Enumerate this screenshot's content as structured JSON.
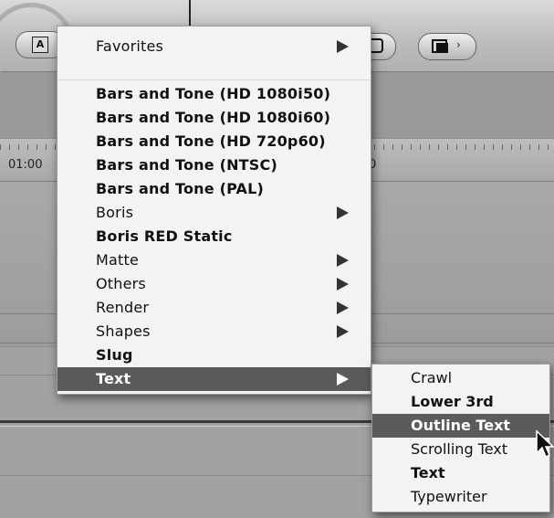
{
  "toolbar": {
    "text_generator_glyph": "A",
    "highlight": "gray ring around generator button",
    "icons": [
      "text-generator-icon",
      "clip-icon",
      "overlay-icon"
    ]
  },
  "timeline": {
    "timecode_left": "01:00",
    "timecode_right": "0"
  },
  "menu": {
    "items": [
      {
        "label": "Favorites",
        "bold": false,
        "submenu": true
      },
      {
        "label": "Bars and Tone (HD 1080i50)",
        "bold": true,
        "submenu": false
      },
      {
        "label": "Bars and Tone (HD 1080i60)",
        "bold": true,
        "submenu": false
      },
      {
        "label": "Bars and Tone (HD 720p60)",
        "bold": true,
        "submenu": false
      },
      {
        "label": "Bars and Tone (NTSC)",
        "bold": true,
        "submenu": false
      },
      {
        "label": "Bars and Tone (PAL)",
        "bold": true,
        "submenu": false
      },
      {
        "label": "Boris",
        "bold": false,
        "submenu": true
      },
      {
        "label": "Boris RED Static",
        "bold": true,
        "submenu": false
      },
      {
        "label": "Matte",
        "bold": false,
        "submenu": true
      },
      {
        "label": "Others",
        "bold": false,
        "submenu": true
      },
      {
        "label": "Render",
        "bold": false,
        "submenu": true
      },
      {
        "label": "Shapes",
        "bold": false,
        "submenu": true
      },
      {
        "label": "Slug",
        "bold": true,
        "submenu": false
      },
      {
        "label": "Text",
        "bold": true,
        "submenu": true,
        "selected": true
      }
    ]
  },
  "submenu": {
    "items": [
      {
        "label": "Crawl",
        "bold": false
      },
      {
        "label": "Lower 3rd",
        "bold": true
      },
      {
        "label": "Outline Text",
        "bold": true,
        "selected": true
      },
      {
        "label": "Scrolling Text",
        "bold": false
      },
      {
        "label": "Text",
        "bold": true
      },
      {
        "label": "Typewriter",
        "bold": false
      }
    ]
  },
  "colors": {
    "menu_bg": "#f3f3f3",
    "selection": "#5b5b5b",
    "window_bg": "#9a9a9a"
  }
}
